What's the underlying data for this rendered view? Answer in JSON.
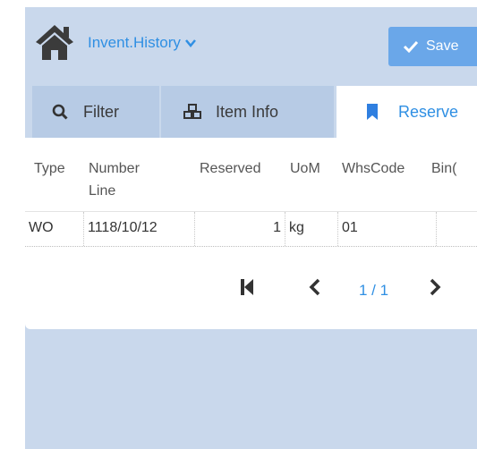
{
  "header": {
    "title": "Invent.History",
    "save_label": "Save"
  },
  "tabs": [
    {
      "label": "Filter",
      "icon": "search-icon"
    },
    {
      "label": "Item Info",
      "icon": "cubes-icon"
    },
    {
      "label": "Reserve",
      "icon": "bookmark-icon"
    }
  ],
  "table": {
    "columns": [
      "Type",
      "Number Line",
      "Reserved",
      "UoM",
      "WhsCode",
      "Bin("
    ],
    "columns_split": {
      "number": "Number",
      "line": "Line"
    },
    "rows": [
      {
        "type": "WO",
        "number": "1118/10/12",
        "reserved": "1",
        "uom": "kg",
        "whscode": "01",
        "bin": ""
      }
    ]
  },
  "pager": {
    "text": "1 / 1"
  },
  "colors": {
    "accent": "#2f8fe3",
    "header_bg": "#c9d8ec",
    "tab_bg": "#b7cbe5",
    "button_bg": "#6aa7e9"
  }
}
